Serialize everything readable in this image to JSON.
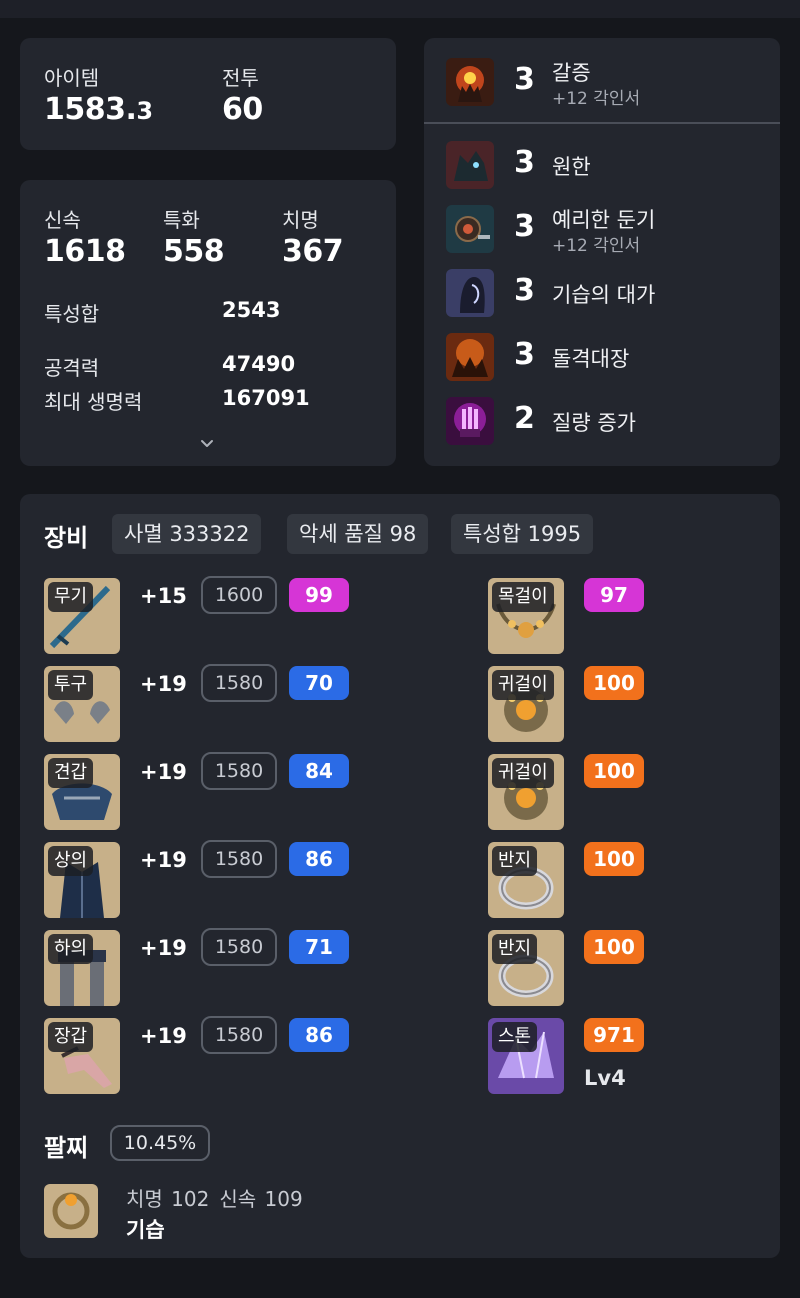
{
  "summary": {
    "item_label": "아이템",
    "item_level_main": "1583.",
    "item_level_frac": "3",
    "combat_label": "전투",
    "combat_level": "60"
  },
  "stats": {
    "swift_label": "신속",
    "swift_value": "1618",
    "spec_label": "특화",
    "spec_value": "558",
    "crit_label": "치명",
    "crit_value": "367",
    "sum_label": "특성합",
    "sum_value": "2543",
    "atk_label": "공격력",
    "atk_value": "47490",
    "hp_label": "최대 생명력",
    "hp_value": "167091",
    "expand_icon": "chevron-down-icon"
  },
  "engravings": [
    {
      "level": "3",
      "name": "갈증",
      "sub": "+12 각인서",
      "icon": "grasping-hand-icon"
    },
    {
      "level": "3",
      "name": "원한",
      "sub": "",
      "icon": "beast-icon"
    },
    {
      "level": "3",
      "name": "예리한 둔기",
      "sub": "+12 각인서",
      "icon": "mace-icon"
    },
    {
      "level": "3",
      "name": "기습의 대가",
      "sub": "",
      "icon": "hooded-figure-icon"
    },
    {
      "level": "3",
      "name": "돌격대장",
      "sub": "",
      "icon": "charge-icon"
    },
    {
      "level": "2",
      "name": "질량 증가",
      "sub": "",
      "icon": "fist-icon"
    }
  ],
  "equipment": {
    "title": "장비",
    "tags": [
      "사멸 333322",
      "악세 품질 98",
      "특성합 1995"
    ],
    "armor": [
      {
        "slot": "무기",
        "refine": "+15",
        "ilvl": "1600",
        "quality": "99",
        "qcolor": "pink",
        "icon": "weapon-icon"
      },
      {
        "slot": "투구",
        "refine": "+19",
        "ilvl": "1580",
        "quality": "70",
        "qcolor": "blue",
        "icon": "helmet-icon"
      },
      {
        "slot": "견갑",
        "refine": "+19",
        "ilvl": "1580",
        "quality": "84",
        "qcolor": "blue",
        "icon": "shoulder-icon"
      },
      {
        "slot": "상의",
        "refine": "+19",
        "ilvl": "1580",
        "quality": "86",
        "qcolor": "blue",
        "icon": "chest-icon"
      },
      {
        "slot": "하의",
        "refine": "+19",
        "ilvl": "1580",
        "quality": "71",
        "qcolor": "blue",
        "icon": "pants-icon"
      },
      {
        "slot": "장갑",
        "refine": "+19",
        "ilvl": "1580",
        "quality": "86",
        "qcolor": "blue",
        "icon": "gloves-icon"
      }
    ],
    "accessories": [
      {
        "slot": "목걸이",
        "quality": "97",
        "qcolor": "pink",
        "icon": "necklace-icon"
      },
      {
        "slot": "귀걸이",
        "quality": "100",
        "qcolor": "orange",
        "icon": "earring-icon"
      },
      {
        "slot": "귀걸이",
        "quality": "100",
        "qcolor": "orange",
        "icon": "earring-icon"
      },
      {
        "slot": "반지",
        "quality": "100",
        "qcolor": "orange",
        "icon": "ring-icon"
      },
      {
        "slot": "반지",
        "quality": "100",
        "qcolor": "orange",
        "icon": "ring-icon"
      },
      {
        "slot": "스톤",
        "quality": "971",
        "qcolor": "orange",
        "icon": "stone-icon"
      }
    ],
    "stone_level": "Lv4"
  },
  "bracelet": {
    "title": "팔찌",
    "percent": "10.45%",
    "stat1": "치명 102",
    "stat2": "신속 109",
    "effect": "기습",
    "icon": "bracelet-icon"
  },
  "colors": {
    "quality_blue": "#2b6be6",
    "quality_pink": "#d635d6",
    "quality_orange": "#f2711c",
    "card_bg": "#23262e",
    "page_bg": "#15171c"
  }
}
